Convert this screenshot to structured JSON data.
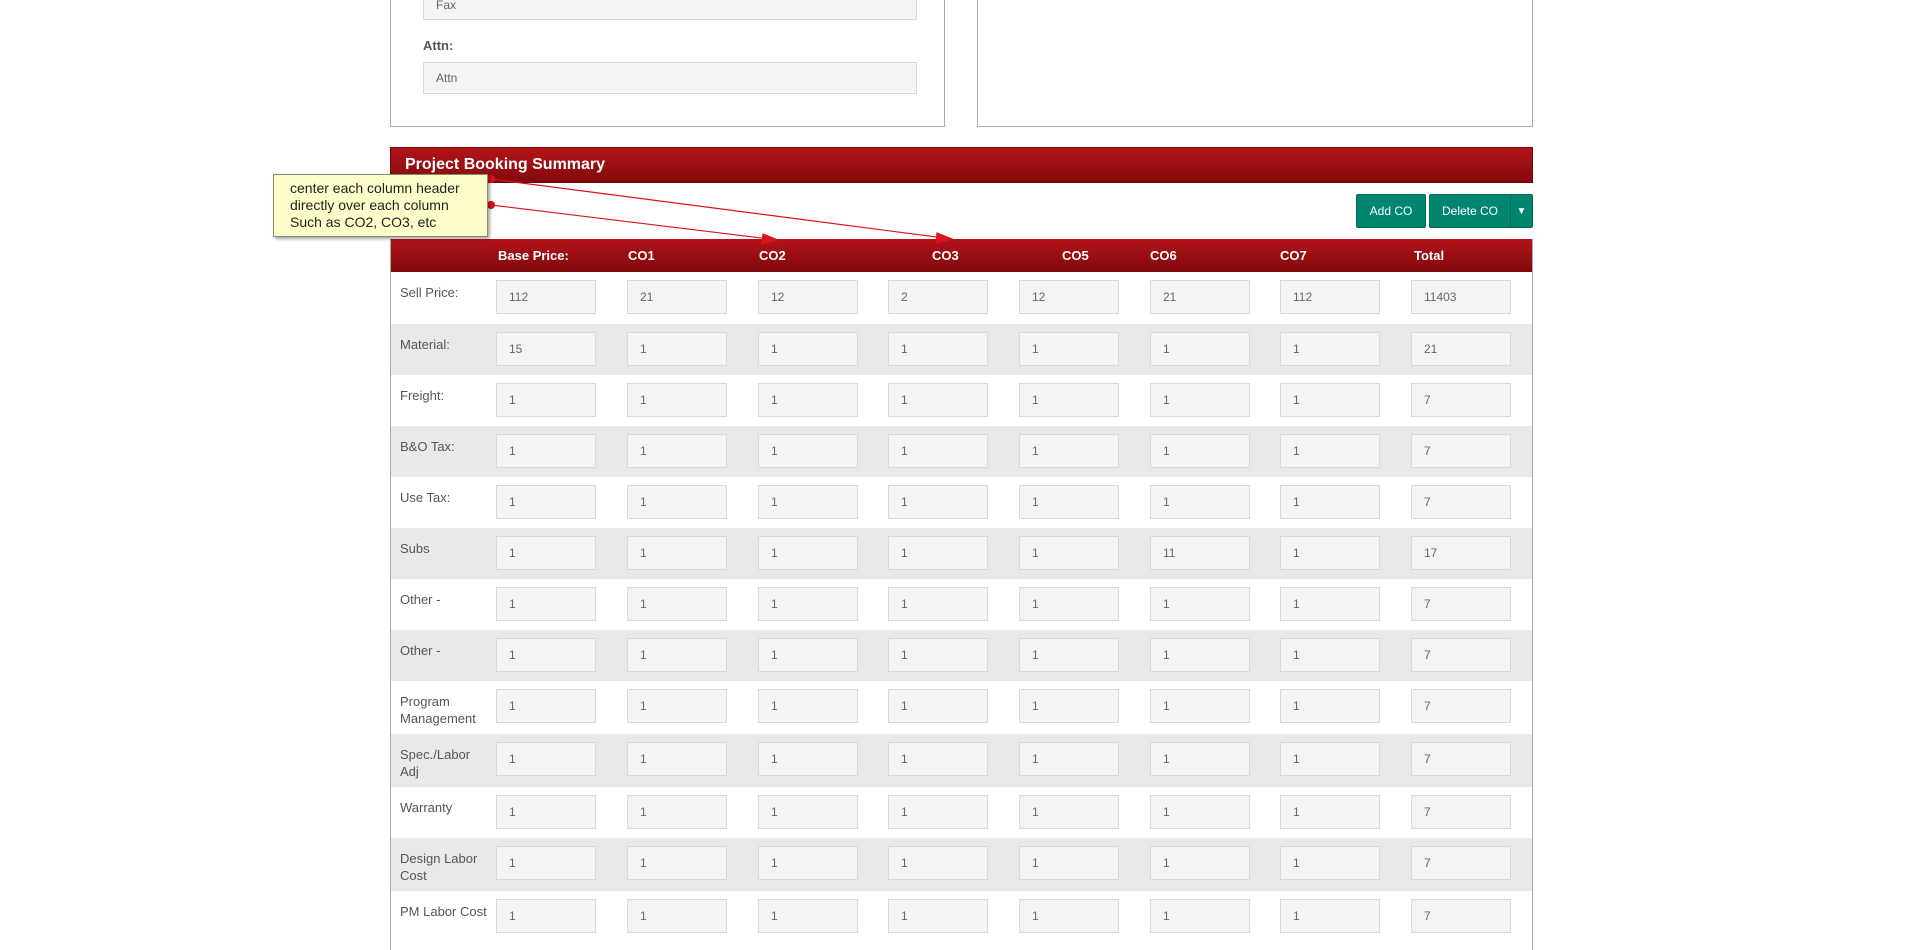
{
  "contact": {
    "fax_placeholder": "Fax",
    "attn_label": "Attn:",
    "attn_placeholder": "Attn"
  },
  "summary": {
    "title": "Project Booking Summary",
    "add_button": "Add CO",
    "delete_button": "Delete CO",
    "caret": "▼"
  },
  "table": {
    "columns": [
      "Base Price:",
      "CO1",
      "CO2",
      "CO3",
      "CO5",
      "CO6",
      "CO7",
      "Total"
    ],
    "rows": [
      {
        "label": "Sell Price:",
        "values": [
          "112",
          "21",
          "12",
          "2",
          "12",
          "21",
          "112",
          "11403"
        ]
      },
      {
        "label": "Material:",
        "values": [
          "15",
          "1",
          "1",
          "1",
          "1",
          "1",
          "1",
          "21"
        ]
      },
      {
        "label": "Freight:",
        "values": [
          "1",
          "1",
          "1",
          "1",
          "1",
          "1",
          "1",
          "7"
        ]
      },
      {
        "label": "B&O Tax:",
        "values": [
          "1",
          "1",
          "1",
          "1",
          "1",
          "1",
          "1",
          "7"
        ]
      },
      {
        "label": "Use Tax:",
        "values": [
          "1",
          "1",
          "1",
          "1",
          "1",
          "1",
          "1",
          "7"
        ]
      },
      {
        "label": "Subs",
        "values": [
          "1",
          "1",
          "1",
          "1",
          "1",
          "11",
          "1",
          "17"
        ]
      },
      {
        "label": "Other -",
        "values": [
          "1",
          "1",
          "1",
          "1",
          "1",
          "1",
          "1",
          "7"
        ]
      },
      {
        "label": "Other -",
        "values": [
          "1",
          "1",
          "1",
          "1",
          "1",
          "1",
          "1",
          "7"
        ]
      },
      {
        "label": "Program Management",
        "values": [
          "1",
          "1",
          "1",
          "1",
          "1",
          "1",
          "1",
          "7"
        ]
      },
      {
        "label": "Spec./Labor Adj",
        "values": [
          "1",
          "1",
          "1",
          "1",
          "1",
          "1",
          "1",
          "7"
        ]
      },
      {
        "label": "Warranty",
        "values": [
          "1",
          "1",
          "1",
          "1",
          "1",
          "1",
          "1",
          "7"
        ]
      },
      {
        "label": "Design Labor Cost",
        "values": [
          "1",
          "1",
          "1",
          "1",
          "1",
          "1",
          "1",
          "7"
        ]
      },
      {
        "label": "PM Labor Cost",
        "values": [
          "1",
          "1",
          "1",
          "1",
          "1",
          "1",
          "1",
          "7"
        ]
      }
    ]
  },
  "annotation": {
    "lines": [
      "center each column header",
      "directly over each column",
      "Such as CO2, CO3, etc"
    ],
    "arrow_color": "#d9141b"
  },
  "colors": {
    "header_red": "#9e1015",
    "button_teal": "#00856f",
    "callout_fill": "#fefecb"
  }
}
